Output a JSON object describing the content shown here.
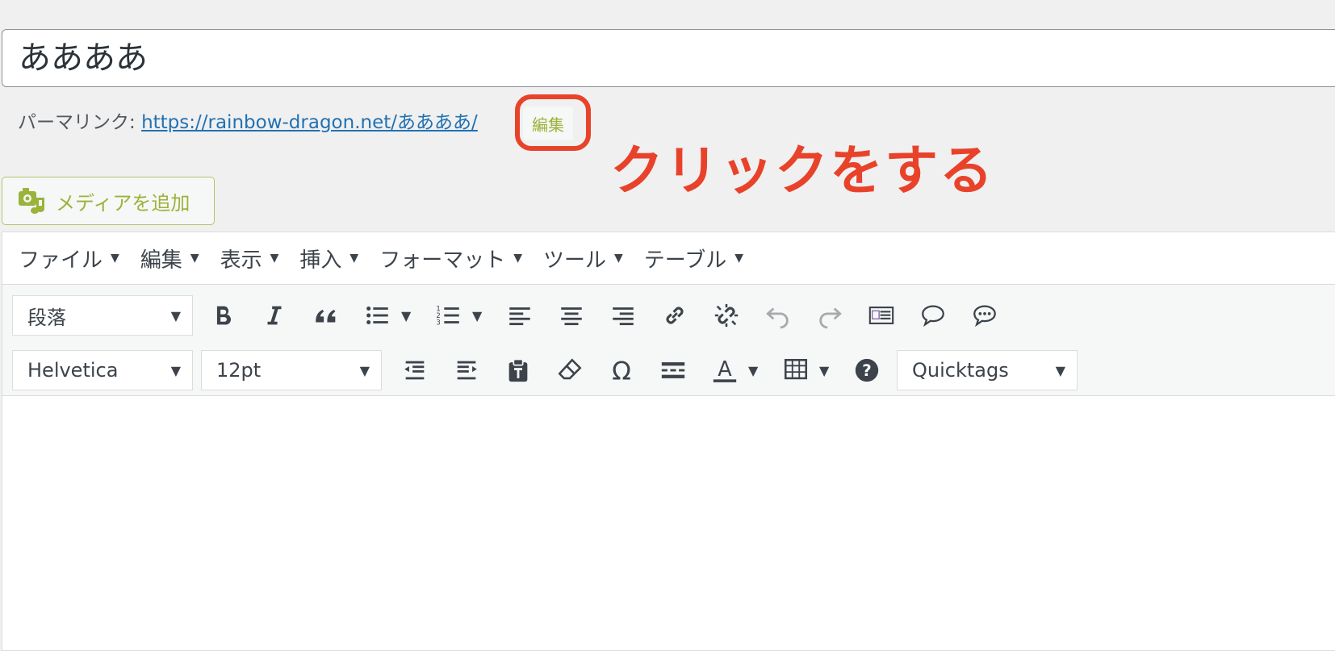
{
  "post_title": "ああああ",
  "permalink": {
    "label": "パーマリンク: ",
    "url": "https://rainbow-dragon.net/ああああ/",
    "edit_button": "編集"
  },
  "annotation": "クリックをする",
  "media_button": {
    "label": "メディアを追加"
  },
  "menubar": [
    {
      "label": "ファイル"
    },
    {
      "label": "編集"
    },
    {
      "label": "表示"
    },
    {
      "label": "挿入"
    },
    {
      "label": "フォーマット"
    },
    {
      "label": "ツール"
    },
    {
      "label": "テーブル"
    }
  ],
  "toolbar": {
    "format_select": "段落",
    "font_family_select": "Helvetica",
    "font_size_select": "12pt",
    "quicktags_select": "Quicktags",
    "icons_row1": [
      "bold-icon",
      "italic-icon",
      "blockquote-icon",
      "bullet-list-icon",
      "numbered-list-icon",
      "align-left-icon",
      "align-center-icon",
      "align-right-icon",
      "link-icon",
      "unlink-icon",
      "undo-icon",
      "redo-icon",
      "read-more-icon",
      "comment-icon",
      "speech-bubble-icon"
    ],
    "icons_row2": [
      "outdent-icon",
      "indent-icon",
      "paste-text-icon",
      "clear-formatting-icon",
      "special-character-icon",
      "horizontal-line-icon",
      "text-color-icon",
      "table-icon",
      "help-icon"
    ]
  },
  "colors": {
    "accent_red": "#e8432a",
    "media_green": "#9bb33a",
    "link_blue": "#2271b1"
  }
}
